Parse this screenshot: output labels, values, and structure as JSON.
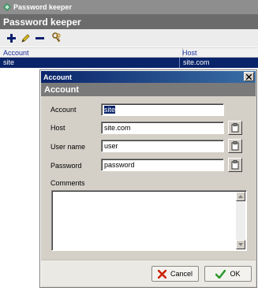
{
  "window": {
    "title": "Password keeper"
  },
  "app": {
    "header": "Password keeper"
  },
  "toolbar": {
    "add_icon": "plus-icon",
    "edit_icon": "pencil-icon",
    "delete_icon": "minus-icon",
    "keys_icon": "keys-icon"
  },
  "grid": {
    "columns": [
      "Account",
      "Host"
    ],
    "rows": [
      {
        "account": "site",
        "host": "site.com"
      }
    ]
  },
  "dialog": {
    "title": "Account",
    "header": "Account",
    "fields": {
      "account": {
        "label": "Account",
        "value": "site"
      },
      "host": {
        "label": "Host",
        "value": "site.com"
      },
      "user": {
        "label": "User name",
        "value": "user"
      },
      "password": {
        "label": "Password",
        "value": "password"
      }
    },
    "comments": {
      "label": "Comments",
      "value": ""
    },
    "buttons": {
      "cancel": "Cancel",
      "ok": "OK"
    }
  },
  "colors": {
    "selection": "#0a246a",
    "dialog_bg": "#d4d0c8",
    "cancel_icon": "#cc2200",
    "ok_icon": "#2e9a2e"
  }
}
